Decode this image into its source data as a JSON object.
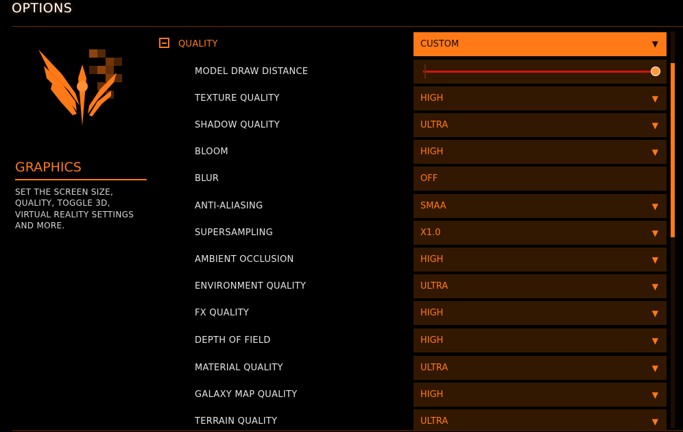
{
  "header": {
    "title": "OPTIONS"
  },
  "sidebar": {
    "logo_icon": "elite-dangerous-logo-icon",
    "section_title": "GRAPHICS",
    "description": "SET THE SCREEN SIZE, QUALITY, TOGGLE 3D, VIRTUAL REALITY SETTINGS AND MORE."
  },
  "quality": {
    "toggle_icon": "collapse-minus-icon",
    "label": "QUALITY",
    "value": "CUSTOM"
  },
  "settings": [
    {
      "label": "MODEL DRAW DISTANCE",
      "type": "slider",
      "level": 1.0
    },
    {
      "label": "TEXTURE QUALITY",
      "value": "HIGH"
    },
    {
      "label": "SHADOW QUALITY",
      "value": "ULTRA"
    },
    {
      "label": "BLOOM",
      "value": "HIGH"
    },
    {
      "label": "BLUR",
      "value": "OFF"
    },
    {
      "label": "ANTI-ALIASING",
      "value": "SMAA"
    },
    {
      "label": "SUPERSAMPLING",
      "value": "X1.0"
    },
    {
      "label": "AMBIENT OCCLUSION",
      "value": "HIGH"
    },
    {
      "label": "ENVIRONMENT QUALITY",
      "value": "ULTRA"
    },
    {
      "label": "FX QUALITY",
      "value": "HIGH"
    },
    {
      "label": "DEPTH OF FIELD",
      "value": "HIGH"
    },
    {
      "label": "MATERIAL QUALITY",
      "value": "ULTRA"
    },
    {
      "label": "GALAXY MAP QUALITY",
      "value": "HIGH"
    },
    {
      "label": "TERRAIN QUALITY",
      "value": "ULTRA"
    }
  ],
  "scroll": {
    "position_fraction": 0.08,
    "visible_fraction": 0.44
  },
  "colors": {
    "accent": "#ff7a16",
    "control_bg": "#331801",
    "slider_track": "#d4140a",
    "background": "#000000"
  }
}
